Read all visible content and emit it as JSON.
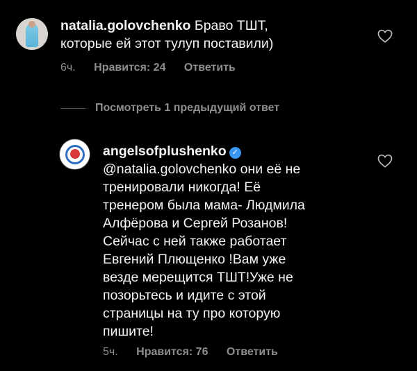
{
  "comment1": {
    "username": "natalia.golovchenko",
    "text_line1": "Браво ТШТ,",
    "text_line2": "которые ей этот тулуп поставили)",
    "time": "6ч.",
    "likes": "Нравится: 24",
    "reply": "Ответить",
    "avatar_icon": "avatar-photo"
  },
  "view_replies": {
    "label": "Посмотреть 1 предыдущий ответ"
  },
  "comment2": {
    "username": "angelsofplushenko",
    "verified_icon": "verified-badge-icon",
    "lines": [
      "@natalia.golovchenko  они её не",
      "тренировали никогда! Её",
      "тренером была мама- Людмила",
      "Алфёрова  и Сергей Розанов!",
      "Сейчас с ней также работает",
      "Евгений Плющенко !Вам уже",
      "везде мерещится ТШТ!Уже не",
      "позорьтесь и идите с этой",
      "страницы на ту про которую",
      "пишите!"
    ],
    "time": "5ч.",
    "likes": "Нравится: 76",
    "reply": "Ответить",
    "avatar_icon": "angels-logo-avatar"
  },
  "colors": {
    "background": "#000000",
    "text": "#f3f3f3",
    "muted": "#8e8e8e",
    "verified": "#3897f0"
  }
}
